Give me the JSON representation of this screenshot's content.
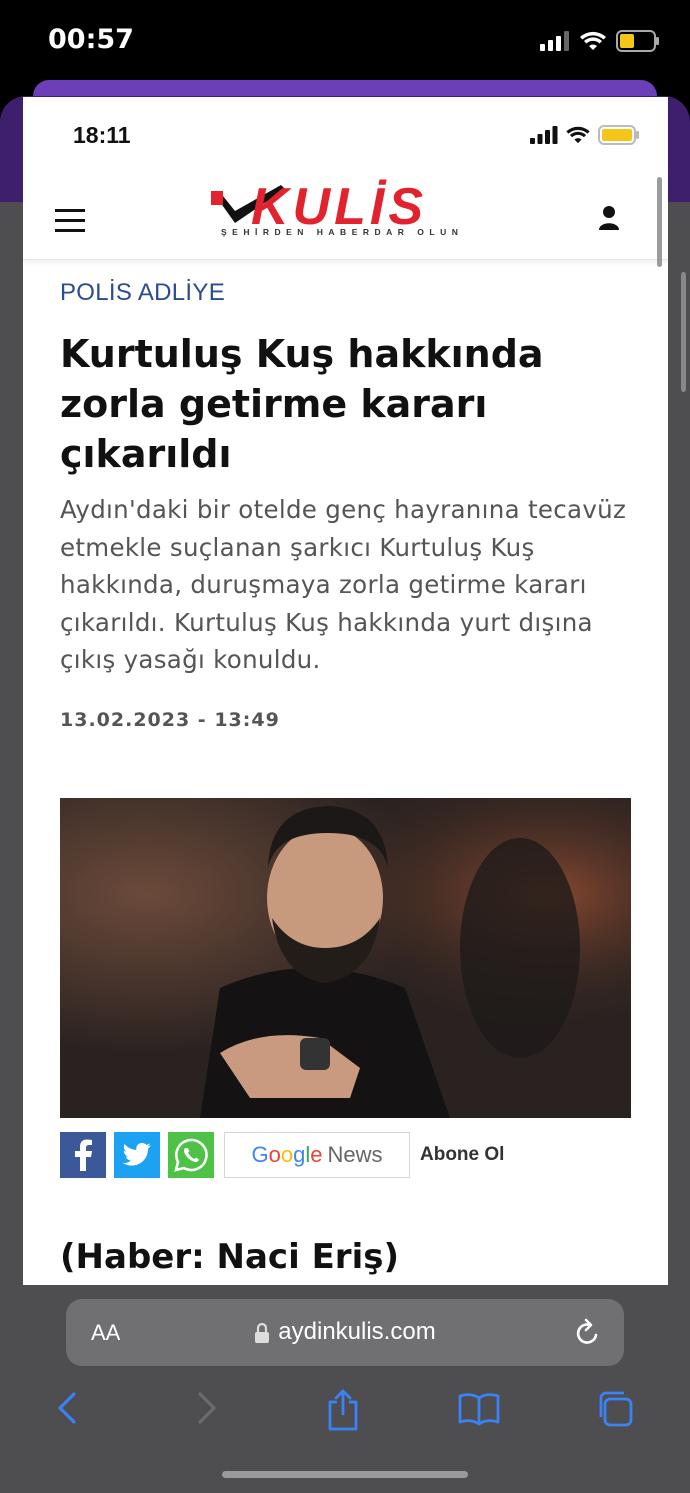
{
  "outer_status": {
    "time": "00:57"
  },
  "inner_status": {
    "time": "18:11"
  },
  "site": {
    "logo_text": "KULİS",
    "logo_tagline": "ŞEHİRDEN HABERDAR OLUN"
  },
  "article": {
    "category": "POLİS ADLİYE",
    "headline": "Kurtuluş Kuş hakkında zorla getirme kararı çıkarıldı",
    "summary": "Aydın'daki bir otelde genç hayranına tecavüz etmekle suçlanan şarkıcı Kurtuluş Kuş hakkında, duruşmaya zorla getirme kararı çıkarıldı. Kurtuluş Kuş hakkında yurt dışına çıkış yasağı konuldu.",
    "date": "13.02.2023 - 13:49",
    "byline": "(Haber: Naci Eriş)"
  },
  "share": {
    "google_news": {
      "g": "G",
      "o1": "o",
      "o2": "o",
      "g2": "g",
      "l": "l",
      "e": "e",
      "news": "News"
    },
    "subscribe": "Abone Ol"
  },
  "browser": {
    "text_size": "AA",
    "url": "aydinkulis.com"
  },
  "colors": {
    "brand_red": "#e2232d",
    "category_blue": "#2b4b93",
    "facebook": "#3b5998",
    "twitter": "#1da1f2",
    "whatsapp": "#4dc247",
    "safari_blue": "#3b82f6"
  },
  "icons": [
    "menu-icon",
    "user-icon",
    "facebook-icon",
    "twitter-icon",
    "whatsapp-icon",
    "lock-icon",
    "reload-icon",
    "back-icon",
    "forward-icon",
    "share-icon",
    "bookmarks-icon",
    "tabs-icon"
  ]
}
